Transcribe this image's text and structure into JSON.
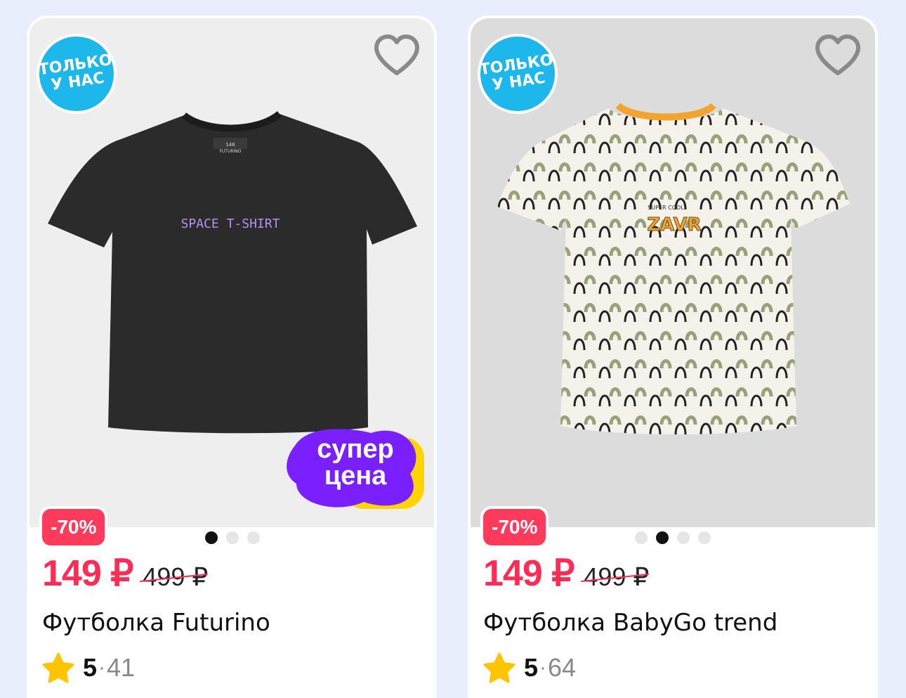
{
  "colors": {
    "price": "#ff2c55",
    "discount_badge": "#ff3b5c",
    "only_badge": "#1eb7ec",
    "super_price_purple": "#7a1fff",
    "super_price_yellow": "#ffd400",
    "star": "#ffc400"
  },
  "products": [
    {
      "only_badge": [
        "ТОЛЬКО",
        "У НАС"
      ],
      "favorite_icon": "heart-outline-icon",
      "print_text": "SPACE T-SHIRT",
      "label_text_1": "146",
      "label_text_2": "FUTURINO",
      "super_price": [
        "супер",
        "цена"
      ],
      "discount": "-70%",
      "dots_total": 3,
      "dots_active_index": 0,
      "price": "149 ₽",
      "old_price": "499 ₽",
      "title": "Футболка Futurino",
      "rating": "5",
      "reviews": "41"
    },
    {
      "only_badge": [
        "ТОЛЬКО",
        "У НАС"
      ],
      "favorite_icon": "heart-outline-icon",
      "print_text_small": "SUPER COOL",
      "print_text": "ZAVR",
      "discount": "-70%",
      "dots_total": 4,
      "dots_active_index": 1,
      "price": "149 ₽",
      "old_price": "499 ₽",
      "title": "Футболка BabyGo trend",
      "rating": "5",
      "reviews": "64"
    }
  ]
}
